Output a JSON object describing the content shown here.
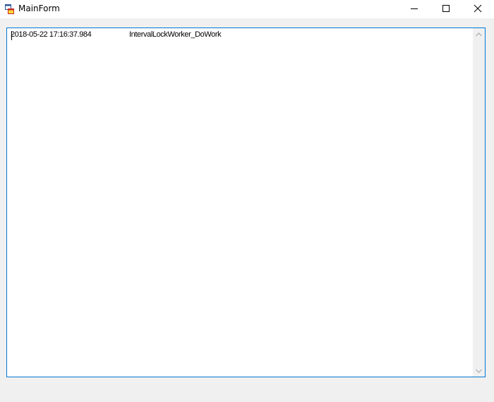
{
  "window": {
    "title": "MainForm"
  },
  "log": {
    "lines": [
      {
        "time": "2018-05-22 17:16:37.984",
        "message": "IntervalLockWorker_DoWork"
      }
    ]
  },
  "colors": {
    "focus_border": "#0078d7",
    "client_background": "#f0f0f0",
    "titlebar_background": "#ffffff"
  },
  "icons": {
    "app": "app-icon",
    "minimize": "minimize-icon",
    "maximize": "maximize-icon",
    "close": "close-icon",
    "scroll_up": "chevron-up-icon",
    "scroll_down": "chevron-down-icon"
  }
}
